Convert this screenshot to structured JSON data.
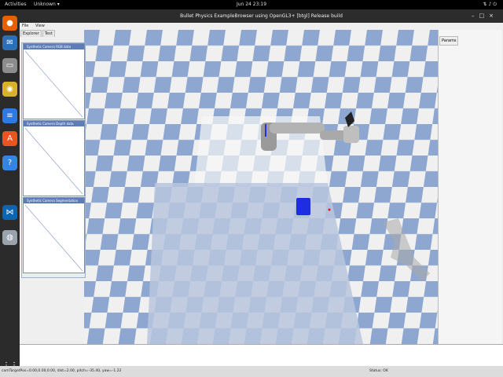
{
  "topbar": {
    "activities": "Activities",
    "app_menu": "Unknown ▾",
    "clock": "Jun 24  23:19"
  },
  "window": {
    "title": "Bullet Physics ExampleBrowser using OpenGL3+ [btgl] Release build",
    "menu": [
      "File",
      "View"
    ],
    "tabs": [
      "Explorer",
      "Test"
    ]
  },
  "cameras": [
    {
      "title": "Synthetic Camera RGB data"
    },
    {
      "title": "Synthetic Camera Depth data"
    },
    {
      "title": "Synthetic Camera Segmentation Mask"
    }
  ],
  "params": {
    "title": "Params"
  },
  "status": {
    "left": "camTargetPos=0.00,0.00,0.00, dist=2.00, pitch=-35.40, yaw=-1.22",
    "right": "Status: OK"
  },
  "colors": {
    "accent": "#5d7db6",
    "floor_light": "#f0f0f0",
    "floor_dark": "#8ea7d0",
    "cube": "#1e2de0"
  },
  "dock_icons": [
    "firefox-icon",
    "thunderbird-icon",
    "files-icon",
    "rhythmbox-icon",
    "writer-icon",
    "appcenter-icon",
    "help-icon",
    "code-icon",
    "disc-icon",
    "grid-apps-icon"
  ]
}
